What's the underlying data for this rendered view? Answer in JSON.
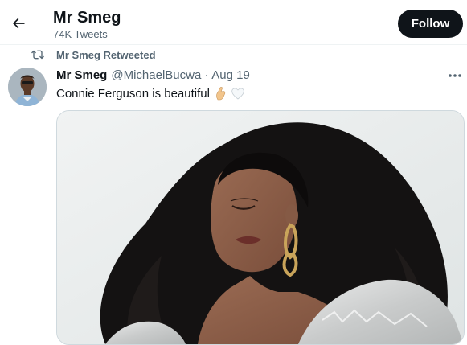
{
  "header": {
    "title": "Mr Smeg",
    "tweet_count": "74K Tweets",
    "follow_label": "Follow"
  },
  "retweet": {
    "label": "Mr Smeg Retweeted"
  },
  "tweet": {
    "name": "Mr Smeg",
    "handle": "@MichaelBucwa",
    "separator": "·",
    "date": "Aug 19",
    "text": "Connie Ferguson is beautiful"
  },
  "icons": {
    "back": "arrow-left-icon",
    "retweet": "retweet-icon",
    "more": "more-horizontal-icon",
    "emoji_1": "pinched-fingers-emoji",
    "emoji_2": "white-heart-emoji"
  },
  "colors": {
    "primary_text": "#0f1419",
    "secondary_text": "#536471",
    "follow_bg": "#0f1419",
    "divider": "#eff3f4"
  }
}
